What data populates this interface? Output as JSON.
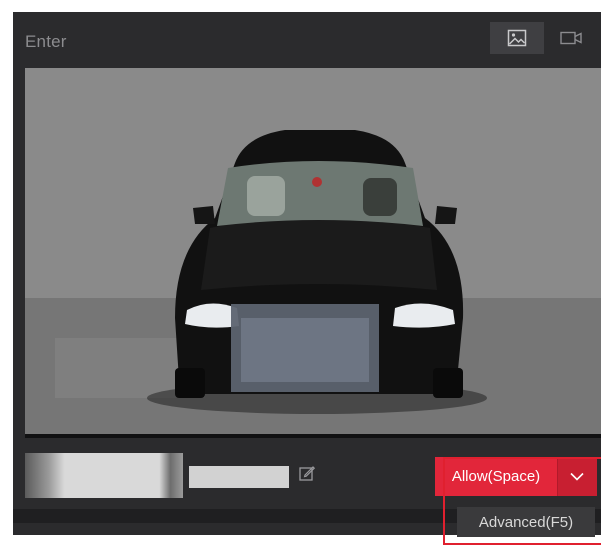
{
  "panel": {
    "title": "Enter",
    "mode_buttons": [
      {
        "name": "image-mode",
        "icon": "image-icon",
        "active": true
      },
      {
        "name": "video-mode",
        "icon": "video-camera-icon",
        "active": false
      }
    ]
  },
  "camera": {
    "subject": "black-sedan-front-view",
    "plate_blurred": true
  },
  "plate": {
    "thumbnail_redacted": true,
    "text_redacted": true,
    "edit_icon": "edit-icon"
  },
  "actions": {
    "allow_label": "Allow(Space)",
    "dropdown_icon": "chevron-down-icon",
    "menu_items": [
      "Advanced(F5)"
    ]
  },
  "colors": {
    "panel_bg": "#2b2b2d",
    "accent_red": "#e2263a",
    "highlight_border": "#e0202f",
    "menu_bg": "#3a3a3c"
  }
}
